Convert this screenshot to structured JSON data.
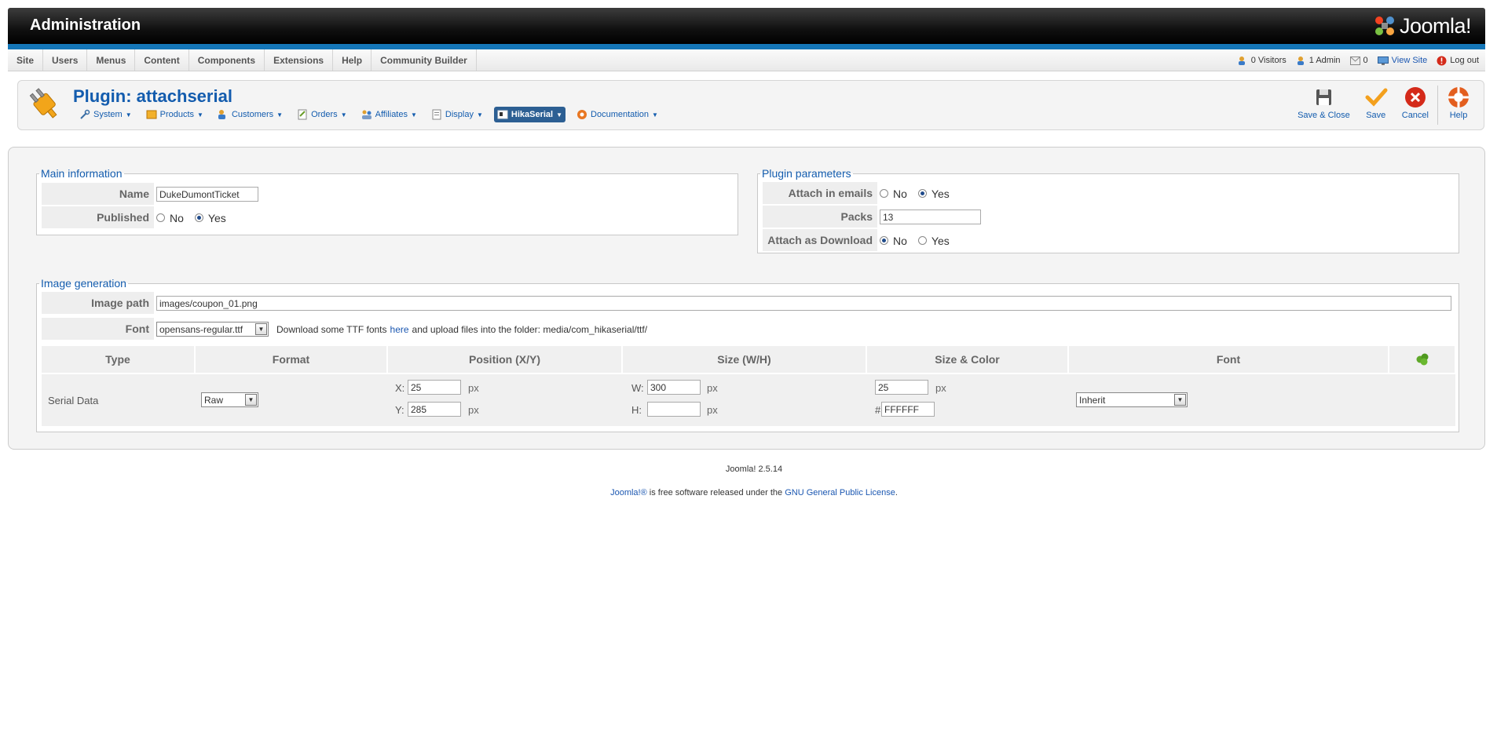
{
  "header": {
    "title": "Administration",
    "logo_text": "Joomla!"
  },
  "menu": {
    "items": [
      "Site",
      "Users",
      "Menus",
      "Content",
      "Components",
      "Extensions",
      "Help",
      "Community Builder"
    ]
  },
  "status": {
    "visitors": "0 Visitors",
    "admins": "1 Admin",
    "messages": "0",
    "view_site": "View Site",
    "logout": "Log out"
  },
  "page": {
    "title": "Plugin: attachserial"
  },
  "submenu": [
    "System",
    "Products",
    "Customers",
    "Orders",
    "Affiliates",
    "Display",
    "HikaSerial",
    "Documentation"
  ],
  "toolbar": {
    "save_close": "Save & Close",
    "save": "Save",
    "cancel": "Cancel",
    "help": "Help"
  },
  "main_info": {
    "legend": "Main information",
    "name_label": "Name",
    "name_value": "DukeDumontTicket",
    "published_label": "Published",
    "no": "No",
    "yes": "Yes"
  },
  "plugin_params": {
    "legend": "Plugin parameters",
    "attach_emails_label": "Attach in emails",
    "packs_label": "Packs",
    "packs_value": "13",
    "attach_download_label": "Attach as Download",
    "no": "No",
    "yes": "Yes"
  },
  "image_gen": {
    "legend": "Image generation",
    "image_path_label": "Image path",
    "image_path_value": "images/coupon_01.png",
    "font_label": "Font",
    "font_value": "opensans-regular.ttf",
    "font_hint_pre": "Download some TTF fonts",
    "font_hint_link": "here",
    "font_hint_post": "and upload files into the folder: media/com_hikaserial/ttf/",
    "columns": [
      "Type",
      "Format",
      "Position (X/Y)",
      "Size (W/H)",
      "Size & Color",
      "Font"
    ],
    "row": {
      "type": "Serial Data",
      "format": "Raw",
      "x_label": "X:",
      "x_value": "25",
      "y_label": "Y:",
      "y_value": "285",
      "w_label": "W:",
      "w_value": "300",
      "h_label": "H:",
      "h_value": "",
      "size_value": "25",
      "color_prefix": "#",
      "color_value": "FFFFFF",
      "font": "Inherit",
      "unit": "px"
    }
  },
  "footer": {
    "version": "Joomla! 2.5.14",
    "license_link1": "Joomla!®",
    "license_text": "is free software released under the",
    "license_link2": "GNU General Public License",
    "license_end": "."
  },
  "colors": {
    "accent": "#135cae",
    "header_strip": "#1476b8"
  }
}
